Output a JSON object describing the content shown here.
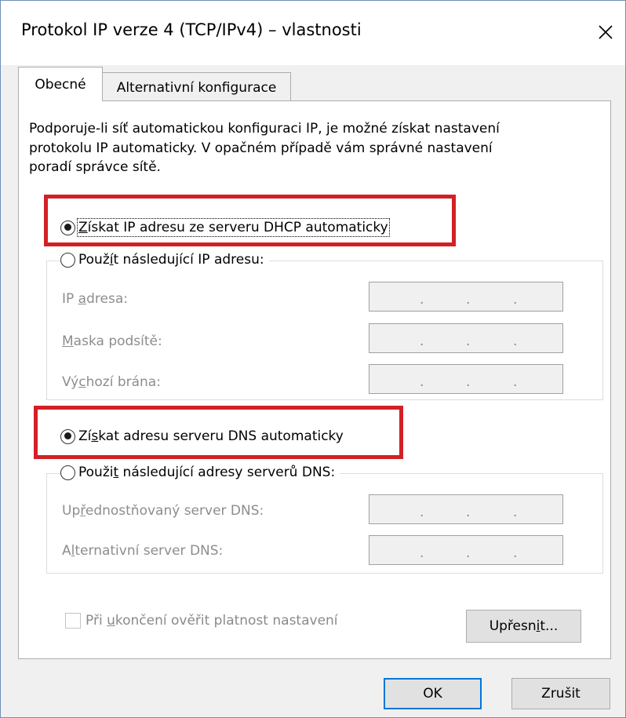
{
  "window": {
    "title": "Protokol IP verze 4 (TCP/IPv4) – vlastnosti",
    "close_glyph": "✕"
  },
  "tabs": [
    {
      "label": "Obecné",
      "active": true
    },
    {
      "label": "Alternativní konfigurace",
      "active": false
    }
  ],
  "description": [
    "Podporuje-li síť automatickou konfiguraci IP, je možné získat nastavení",
    "protokolu IP automaticky. V opačném případě vám správné nastavení",
    "poradí správce sítě."
  ],
  "ip_section": {
    "auto_option": {
      "pre": "",
      "mnemonic": "Z",
      "post": "ískat IP adresu ze serveru DHCP automaticky",
      "checked": true
    },
    "manual_option": {
      "pre": "Použ",
      "mnemonic": "í",
      "post": "t následující IP adresu:",
      "checked": false
    },
    "fields": [
      {
        "pre": "IP ",
        "mnemonic": "a",
        "post": "dresa:",
        "value": ". . ."
      },
      {
        "pre": "",
        "mnemonic": "M",
        "post": "aska podsítě:",
        "value": ". . ."
      },
      {
        "pre": "Vý",
        "mnemonic": "c",
        "post": "hozí brána:",
        "value": ". . ."
      }
    ]
  },
  "dns_section": {
    "auto_option": {
      "pre": "Zí",
      "mnemonic": "s",
      "post": "kat adresu serveru DNS automaticky",
      "checked": true
    },
    "manual_option": {
      "pre": "Použi",
      "mnemonic": "t",
      "post": " následující adresy serverů DNS:",
      "checked": false
    },
    "fields": [
      {
        "pre": "Up",
        "mnemonic": "ř",
        "post": "ednostňovaný server DNS:",
        "value": ". . ."
      },
      {
        "pre": "A",
        "mnemonic": "l",
        "post": "ternativní server DNS:",
        "value": ". . ."
      }
    ]
  },
  "validate_checkbox": {
    "pre": "Při ",
    "mnemonic": "u",
    "post": "končení ověřit platnost nastavení",
    "checked": false
  },
  "buttons": {
    "advanced": {
      "pre": "Upřesn",
      "mnemonic": "i",
      "post": "t..."
    },
    "ok": "OK",
    "cancel": "Zrušit"
  },
  "colors": {
    "highlight": "#d32027",
    "default_button_border": "#0078d7",
    "disabled_text": "#8d8d8d"
  }
}
